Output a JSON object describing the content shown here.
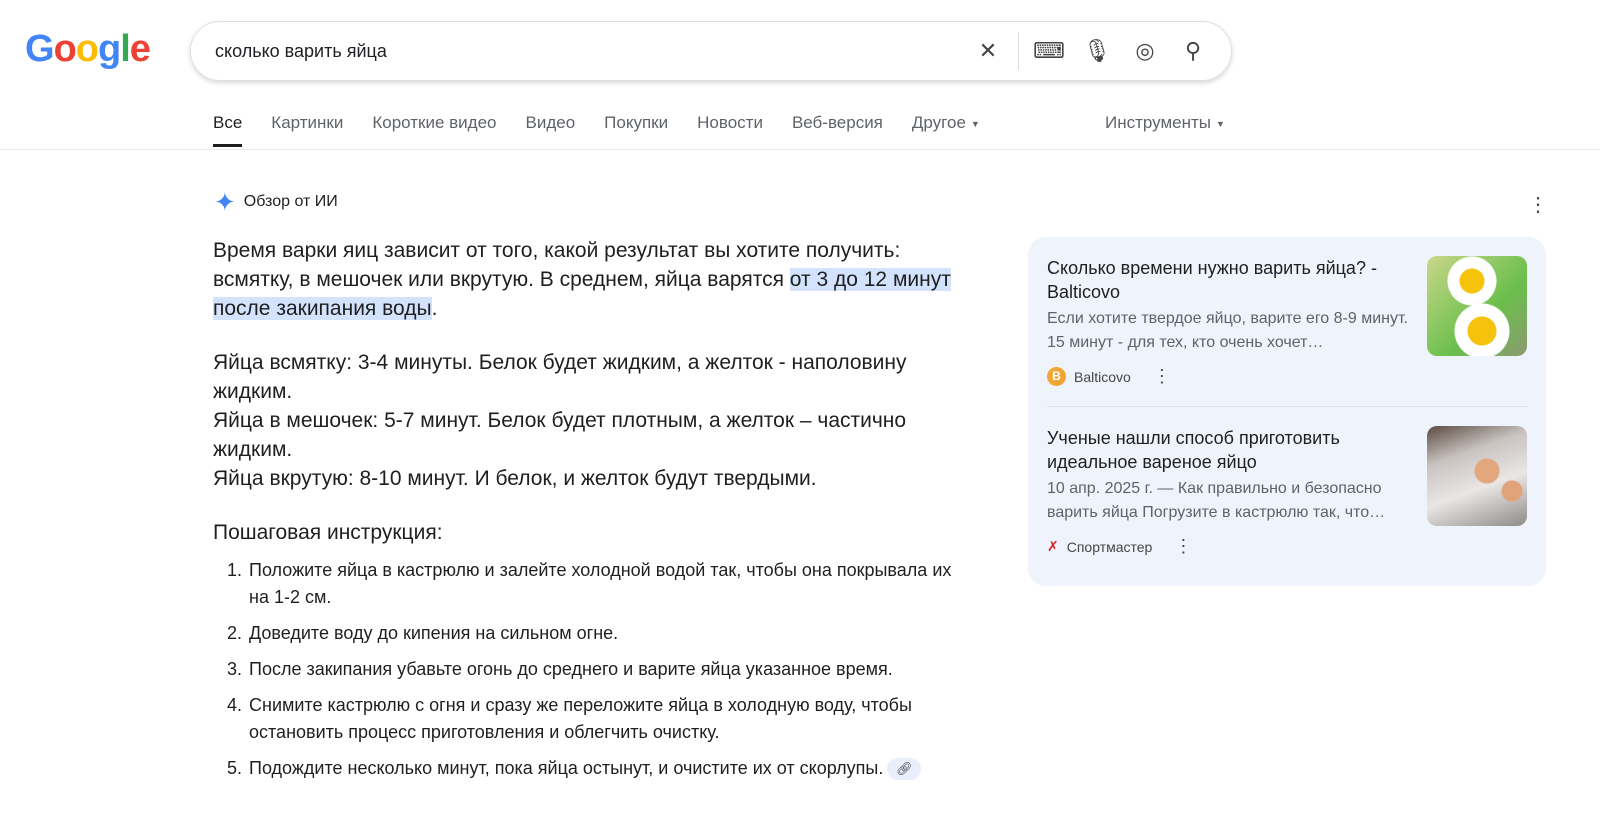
{
  "logo": "Google",
  "search": {
    "query": "сколько варить яйца",
    "icons": [
      "clear-icon",
      "keyboard-icon",
      "mic-icon",
      "lens-icon",
      "search-icon"
    ]
  },
  "tabs": [
    {
      "label": "Все"
    },
    {
      "label": "Картинки"
    },
    {
      "label": "Короткие видео"
    },
    {
      "label": "Видео"
    },
    {
      "label": "Покупки"
    },
    {
      "label": "Новости"
    },
    {
      "label": "Веб-версия"
    },
    {
      "label": "Другое"
    }
  ],
  "tools": "Инструменты",
  "ai": {
    "title": "Обзор от ИИ",
    "intro_a": "Время варки яиц зависит от того, какой результат вы хотите получить: всмятку, в мешочек или вкрутую. В среднем, яйца варятся ",
    "intro_hl": "от 3 до 12 минут после закипания воды",
    "intro_end": ".",
    "lines": [
      "Яйца всмятку: 3-4 минуты. Белок будет жидким, а желток - наполовину жидким.",
      "Яйца в мешочек: 5-7 минут. Белок будет плотным, а желток – частично жидким.",
      "Яйца вкрутую: 8-10 минут. И белок, и желток будут твердыми."
    ],
    "steps_title": "Пошаговая инструкция:",
    "steps": [
      "Положите яйца в кастрюлю и залейте холодной водой так, чтобы она покрывала их на 1-2 см.",
      "Доведите воду до кипения на сильном огне.",
      "После закипания убавьте огонь до среднего и варите яйца указанное время.",
      "Снимите кастрюлю с огня и сразу же переложите яйца в холодную воду, чтобы остановить процесс приготовления и облегчить очистку.",
      "Подождите несколько минут, пока яйца остынут, и очистите их от скорлупы."
    ]
  },
  "sources": [
    {
      "title": "Сколько времени нужно варить яйца? - Balticovo",
      "snippet": "Если хотите твердое яйцо, варите его 8-9 минут. 15 минут - для тех, кто очень хочет…",
      "site": "Balticovo",
      "fav": "B"
    },
    {
      "title": "Ученые нашли способ приготовить идеальное вареное яйцо",
      "snippet": "10 апр. 2025 г. — Как правильно и безопасно варить яйца Погрузите в кастрюлю так, что…",
      "site": "Спортмастер"
    }
  ]
}
